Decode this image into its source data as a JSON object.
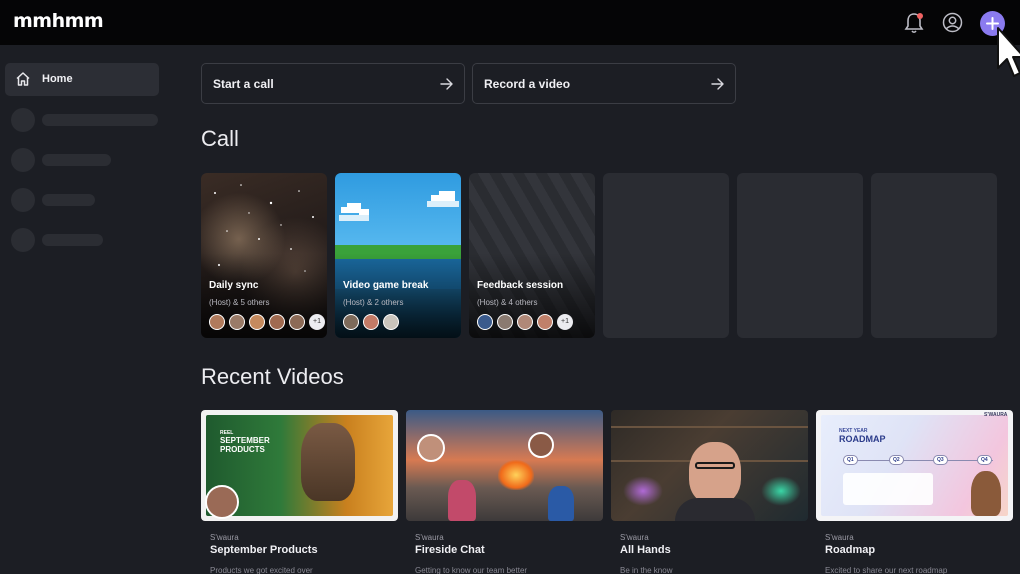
{
  "app": {
    "logo": "mmhmm"
  },
  "colors": {
    "accent": "#8b7bf0",
    "notification_dot": "#f06262",
    "background": "#1c1e24",
    "topbar": "#050506"
  },
  "topbar": {
    "icons": [
      "bell-icon",
      "account-icon",
      "plus-icon"
    ]
  },
  "sidebar": {
    "home_label": "Home"
  },
  "actions": [
    {
      "label": "Start a call"
    },
    {
      "label": "Record a video"
    }
  ],
  "call_section": {
    "title": "Call",
    "cards": [
      {
        "title": "Daily sync",
        "hosts": "(Host) & 5 others",
        "more": "+1"
      },
      {
        "title": "Video game break",
        "hosts": "(Host) & 2 others"
      },
      {
        "title": "Feedback session",
        "hosts": "(Host) & 4 others",
        "more": "+1"
      }
    ]
  },
  "videos_section": {
    "title": "Recent Videos",
    "videos": [
      {
        "author": "S'waura",
        "title": "September Products",
        "description": "Products we got excited over",
        "thumb_small": "REEL",
        "thumb_big": "SEPTEMBER PRODUCTS"
      },
      {
        "author": "S'waura",
        "title": "Fireside Chat",
        "description": "Getting to know our team better"
      },
      {
        "author": "S'waura",
        "title": "All Hands",
        "description": "Be in the know"
      },
      {
        "author": "S'waura",
        "title": "Roadmap",
        "description": "Excited to share our next roadmap",
        "thumb_small": "NEXT YEAR",
        "thumb_big": "ROADMAP",
        "thumb_brand": "S'WAURA",
        "thumb_steps": [
          "Q1",
          "Q2",
          "Q3",
          "Q4"
        ]
      }
    ]
  }
}
